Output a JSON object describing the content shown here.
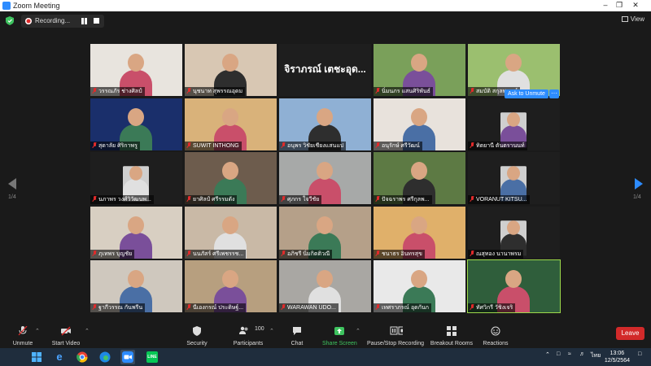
{
  "window": {
    "title": "Zoom Meeting",
    "controls": [
      "minimize-icon",
      "restore-icon",
      "close-icon"
    ]
  },
  "top_bar": {
    "recording_label": "Recording...",
    "view_label": "View"
  },
  "paging": {
    "left": "1/4",
    "right": "1/4"
  },
  "participants": [
    [
      "วรรณภัร ช่างศิลป์",
      "นุชนาท สุพรรณอุดม",
      "จิราภรณ์ เตชะอุด...",
      "นิ่มนภร แสนศิริพันธ์",
      "สมบัติ สกุลพรรณ์"
    ],
    [
      "สุดาลัย ศิริกาพรู",
      "SUWIT INTHONG",
      "อนุพร วิชัยเชียงแสนแป",
      "อนุรักษ์ ศรีวัฒน์",
      "ทิตยานี ตันตรานนท์"
    ],
    [
      "นภาพร วงศ์วิวัฒนพ...",
      "ยาศิลป์ ศรีรรมดัง",
      "ศุภกร ใจวีชัย",
      "ปัจฉราพร ศรีกุลพ...",
      "VORANUT KITSU..."
    ],
    [
      "ภุเทพร บุญชัย",
      "นนภัสร์ ศรีเพชรรช...",
      "อภิชรี นิ่มกิตติวณี",
      "ชนาธร อินทรสุข",
      "ณสุทอง นานาพรม"
    ],
    [
      "ฐากีวรรณ กันพรีน",
      "นีเองกรณ์ ประดิษฐ์...",
      "WARAWAN UDO...",
      "เทศราภรณ์ อุดกันก",
      "ทัศวิกรี วัชิงเจริ"
    ]
  ],
  "overlays": {
    "ask_to_unmute": "Ask to Unmute",
    "more": "···"
  },
  "toolbar": {
    "unmute": "Unmute",
    "start_video": "Start Video",
    "security": "Security",
    "participants": "Participants",
    "participants_count": "100",
    "chat": "Chat",
    "share_screen": "Share Screen",
    "pause_stop_recording": "Pause/Stop Recording",
    "breakout_rooms": "Breakout Rooms",
    "reactions": "Reactions",
    "leave": "Leave"
  },
  "taskbar": {
    "apps": [
      "start-icon",
      "ie-icon",
      "chrome-icon",
      "edge-icon",
      "zoom-icon",
      "line-icon"
    ],
    "language": "ไทย",
    "time": "13:06",
    "date": "12/5/2564"
  },
  "colors": {
    "accent": "#2d8cff",
    "leave": "#d22a2a",
    "share": "#3ec35f",
    "active_speaker": "#9dd94a",
    "muted": "#e02b2b"
  }
}
